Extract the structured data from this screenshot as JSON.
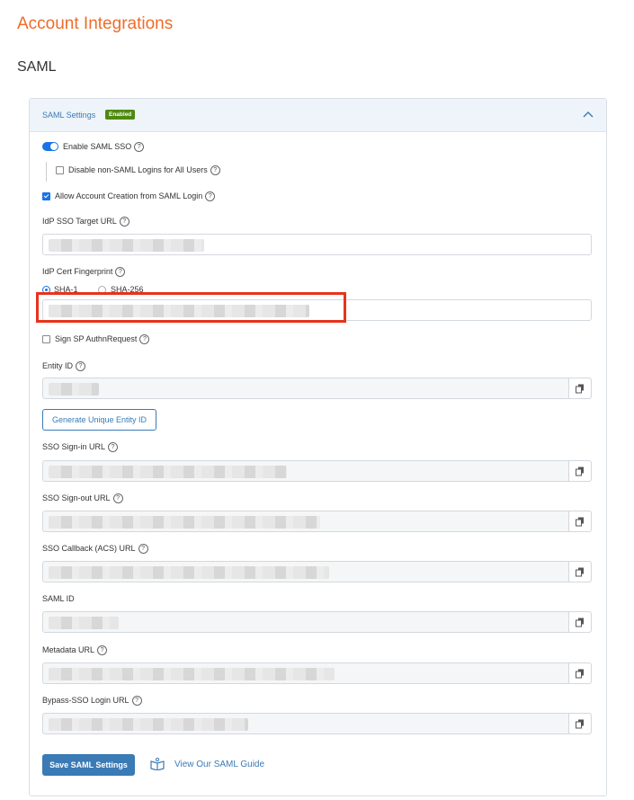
{
  "page": {
    "title": "Account Integrations",
    "section": "SAML"
  },
  "panel": {
    "title": "SAML Settings",
    "badge": "Enabled"
  },
  "options": {
    "enable_sso": "Enable SAML SSO",
    "disable_non_saml": "Disable non-SAML Logins for All Users",
    "allow_account_creation": "Allow Account Creation from SAML Login",
    "sign_sp": "Sign SP AuthnRequest"
  },
  "fields": {
    "idp_target_url": "IdP SSO Target URL",
    "idp_cert_fingerprint": "IdP Cert Fingerprint",
    "sha1": "SHA-1",
    "sha256": "SHA-256",
    "entity_id": "Entity ID",
    "sso_signin_url": "SSO Sign-in URL",
    "sso_signout_url": "SSO Sign-out URL",
    "sso_callback_url": "SSO Callback (ACS) URL",
    "saml_id": "SAML ID",
    "metadata_url": "Metadata URL",
    "bypass_sso_url": "Bypass-SSO Login URL"
  },
  "buttons": {
    "generate_entity_id": "Generate Unique Entity ID",
    "save": "Save SAML Settings",
    "guide": "View Our SAML Guide"
  },
  "state": {
    "enable_sso": true,
    "disable_non_saml": false,
    "allow_account_creation": true,
    "sign_sp": false,
    "fingerprint_algorithm": "SHA-1"
  },
  "colors": {
    "accent": "#ee6c2b",
    "primary": "#3a7ab5",
    "badge": "#4f8a10",
    "highlight": "#e8331c"
  },
  "icons": {
    "collapse": "chevron-up-icon",
    "copy": "copy-icon",
    "guide": "book-icon",
    "help": "question-circle-icon"
  }
}
